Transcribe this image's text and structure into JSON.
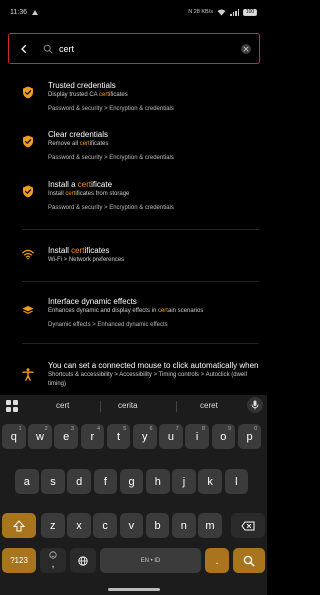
{
  "status_bar": {
    "time": "11:36",
    "right_text": "N 28 KB/s",
    "battery": "100"
  },
  "search": {
    "query": "cert",
    "back_icon": "back-arrow-icon",
    "search_icon": "search-icon",
    "clear_icon": "clear-icon"
  },
  "accent_color": "#f29c1f",
  "results": [
    {
      "icon": "shield-check-icon",
      "title_pre": "Trusted credentials",
      "title_hl": "",
      "title_post": "",
      "sub_pre": "Display trusted CA ",
      "sub_hl": "cert",
      "sub_post": "ificates",
      "path": "Password & security > Encryption & credentials"
    },
    {
      "icon": "shield-check-icon",
      "title_pre": "Clear credentials",
      "title_hl": "",
      "title_post": "",
      "sub_pre": "Remove all ",
      "sub_hl": "cert",
      "sub_post": "ificates",
      "path": "Password & security > Encryption & credentials"
    },
    {
      "icon": "shield-check-icon",
      "title_pre": "Install a ",
      "title_hl": "cert",
      "title_post": "ificate",
      "sub_pre": "Install ",
      "sub_hl": "cert",
      "sub_post": "ificates from storage",
      "path": "Password & security > Encryption & credentials"
    },
    {
      "icon": "wifi-icon",
      "title_pre": "Install ",
      "title_hl": "cert",
      "title_post": "ificates",
      "sub_pre": "Wi-Fi > Network preferences",
      "sub_hl": "",
      "sub_post": "",
      "path": ""
    },
    {
      "icon": "layers-icon",
      "title_pre": "Interface dynamic effects",
      "title_hl": "",
      "title_post": "",
      "sub_pre": "Enhances dynamic and display effects in ",
      "sub_hl": "cert",
      "sub_post": "ain scenarios",
      "path": "Dynamic effects > Enhanced dynamic effects"
    },
    {
      "icon": "accessibility-icon",
      "title_pre": "You can set a connected mouse to click automatically when...",
      "title_hl": "",
      "title_post": "",
      "sub_pre": "Shortcuts & accessibility > Accessibility > Timing controls > Autoclick (dwell timing)",
      "sub_hl": "",
      "sub_post": "",
      "path": ""
    }
  ],
  "keyboard": {
    "suggestions": [
      "cert",
      "cerita",
      "ceret"
    ],
    "row1": [
      {
        "k": "q",
        "a": "1"
      },
      {
        "k": "w",
        "a": "2"
      },
      {
        "k": "e",
        "a": "3"
      },
      {
        "k": "r",
        "a": "4"
      },
      {
        "k": "t",
        "a": "5"
      },
      {
        "k": "y",
        "a": "6"
      },
      {
        "k": "u",
        "a": "7"
      },
      {
        "k": "i",
        "a": "8"
      },
      {
        "k": "o",
        "a": "9"
      },
      {
        "k": "p",
        "a": "0"
      }
    ],
    "row2": [
      "a",
      "s",
      "d",
      "f",
      "g",
      "h",
      "j",
      "k",
      "l"
    ],
    "row3": [
      "z",
      "x",
      "c",
      "v",
      "b",
      "n",
      "m"
    ],
    "symbols_label": "?123",
    "comma_label": ",",
    "space_label": "EN • ID",
    "period_label": ".",
    "shift_icon": "shift-icon",
    "backspace_icon": "backspace-icon",
    "globe_icon": "globe-icon",
    "search_key_icon": "search-icon",
    "mic_icon": "mic-icon",
    "menu_icon": "keyboard-menu-icon",
    "emoji_icon": "emoji-icon"
  }
}
